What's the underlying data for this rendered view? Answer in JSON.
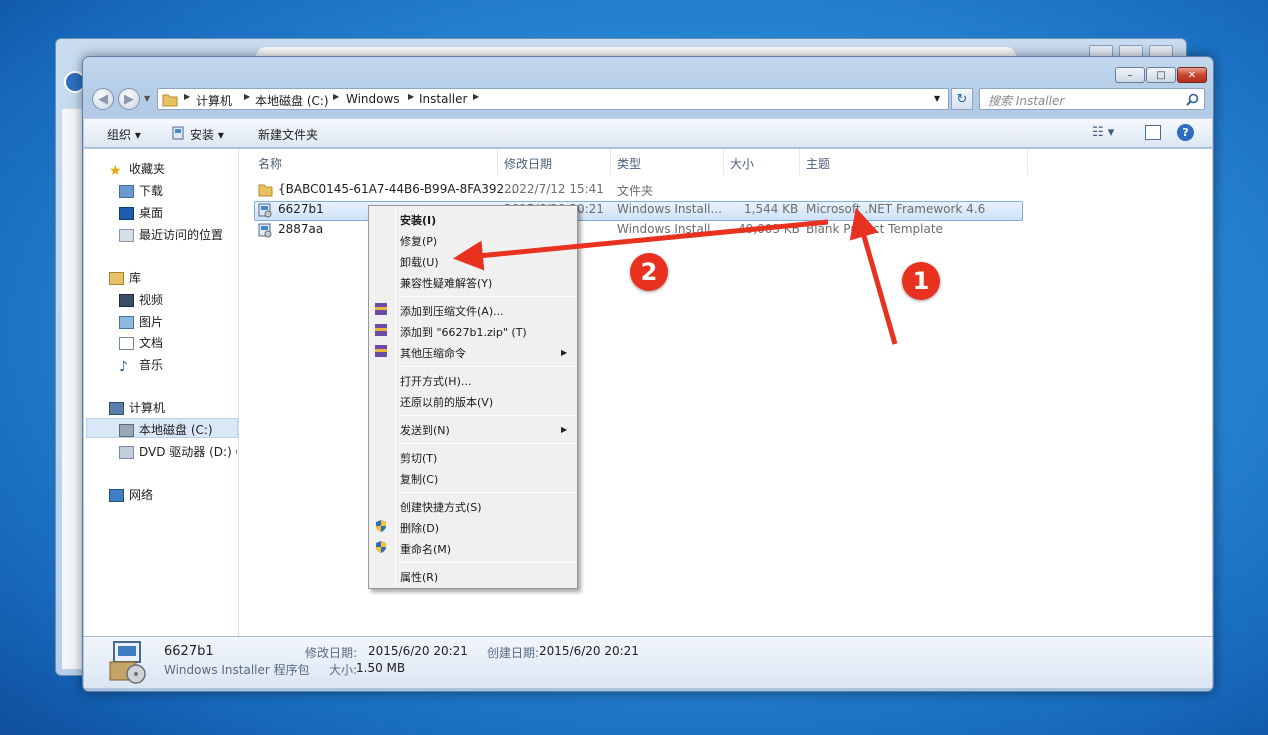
{
  "address": {
    "crumbs": [
      "计算机",
      "本地磁盘 (C:)",
      "Windows",
      "Installer"
    ],
    "search_placeholder": "搜索 Installer"
  },
  "toolbar": {
    "organize": "组织",
    "install": "安装",
    "new_folder": "新建文件夹"
  },
  "navpane": {
    "favorites": "收藏夹",
    "downloads": "下载",
    "desktop": "桌面",
    "recent": "最近访问的位置",
    "libraries": "库",
    "videos": "视频",
    "pictures": "图片",
    "documents": "文档",
    "music": "音乐",
    "computer": "计算机",
    "local_disk": "本地磁盘 (C:)",
    "dvd": "DVD 驱动器 (D:) G",
    "network": "网络"
  },
  "columns": {
    "name": "名称",
    "modified": "修改日期",
    "type": "类型",
    "size": "大小",
    "subject": "主题"
  },
  "files": [
    {
      "name": "{BABC0145-61A7-44B6-B99A-8FA392...",
      "modified": "2022/7/12 15:41",
      "type": "文件夹",
      "size": "",
      "subject": ""
    },
    {
      "name": "6627b1",
      "modified": "2015/6/20 20:21",
      "type": "Windows Install...",
      "size": "1,544 KB",
      "subject": "Microsoft .NET Framework 4.6"
    },
    {
      "name": "2887aa",
      "modified": "",
      "type": "Windows Install...",
      "size": "40,003 KB",
      "subject": "Blank Project Template"
    }
  ],
  "context_menu": {
    "install": "安装(I)",
    "repair": "修复(P)",
    "uninstall": "卸载(U)",
    "compat": "兼容性疑难解答(Y)",
    "add_archive": "添加到压缩文件(A)...",
    "add_zip": "添加到 \"6627b1.zip\" (T)",
    "other_compress": "其他压缩命令",
    "open_with": "打开方式(H)...",
    "restore": "还原以前的版本(V)",
    "send_to": "发送到(N)",
    "cut": "剪切(T)",
    "copy": "复制(C)",
    "shortcut": "创建快捷方式(S)",
    "delete": "删除(D)",
    "rename": "重命名(M)",
    "properties": "属性(R)"
  },
  "details": {
    "name": "6627b1",
    "type": "Windows Installer 程序包",
    "modified_label": "修改日期:",
    "modified": "2015/6/20 20:21",
    "created_label": "创建日期:",
    "created": "2015/6/20 20:21",
    "size_label": "大小:",
    "size": "1.50 MB"
  },
  "annotations": {
    "step1": "1",
    "step2": "2",
    "color": "#e8321f"
  }
}
